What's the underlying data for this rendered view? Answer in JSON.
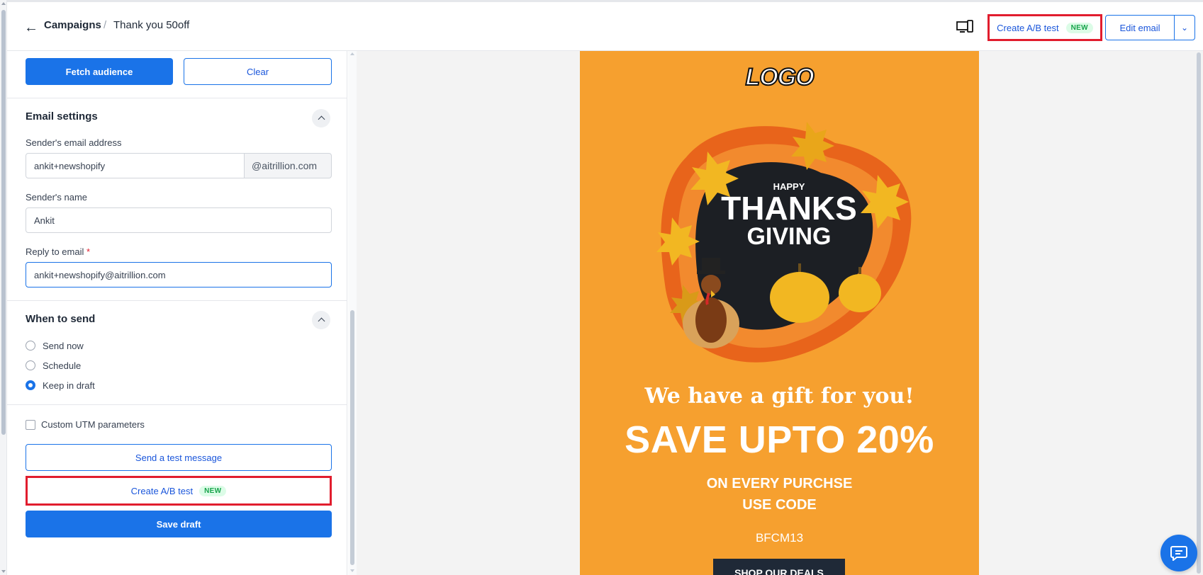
{
  "header": {
    "breadcrumb_parent": "Campaigns",
    "breadcrumb_separator": "/",
    "breadcrumb_current": "Thank you 50off",
    "ab_test_label": "Create A/B test",
    "ab_test_badge": "NEW",
    "edit_email_label": "Edit email"
  },
  "audience": {
    "fetch_label": "Fetch audience",
    "clear_label": "Clear"
  },
  "email_settings": {
    "title": "Email settings",
    "sender_email_label": "Sender's email address",
    "sender_email_value": "ankit+newshopify",
    "sender_email_domain": "@aitrillion.com",
    "sender_name_label": "Sender's name",
    "sender_name_value": "Ankit",
    "reply_to_label": "Reply to email",
    "reply_to_required": "*",
    "reply_to_value": "ankit+newshopify@aitrillion.com"
  },
  "when_to_send": {
    "title": "When to send",
    "options": [
      {
        "label": "Send now",
        "selected": false
      },
      {
        "label": "Schedule",
        "selected": false
      },
      {
        "label": "Keep in draft",
        "selected": true
      }
    ]
  },
  "actions": {
    "utm_label": "Custom UTM parameters",
    "utm_checked": false,
    "test_message_label": "Send a test message",
    "ab_test_label": "Create A/B test",
    "ab_test_badge": "NEW",
    "save_draft_label": "Save draft"
  },
  "email_preview": {
    "logo_text": "LOGO",
    "hero_happy": "HAPPY",
    "hero_thanks": "THANKS",
    "hero_giving": "GIVING",
    "headline": "We have a gift for you!",
    "offer": "SAVE UPTO 20%",
    "line1": "ON EVERY PURCHSE",
    "line2": "USE CODE",
    "code": "BFCM13",
    "cta_label": "SHOP OUR DEALS"
  },
  "colors": {
    "primary": "#1a73e8",
    "highlight_border": "#e11d2e",
    "email_background": "#f6a02f",
    "badge_bg": "#dcfce7",
    "badge_text": "#16a34a"
  },
  "icons": [
    "arrow-left-icon",
    "desktop-mobile-icon",
    "chevron-down-icon",
    "chevron-up-icon",
    "chat-icon"
  ]
}
